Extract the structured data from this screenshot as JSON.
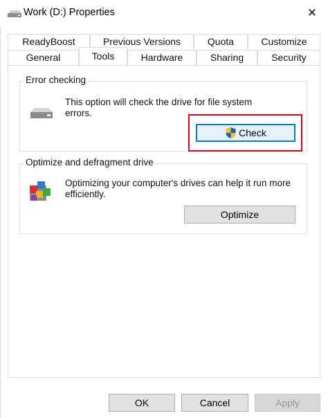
{
  "window": {
    "title": "Work (D:) Properties",
    "close_label": "✕"
  },
  "tabs_row1": [
    "ReadyBoost",
    "Previous Versions",
    "Quota",
    "Customize"
  ],
  "tabs_row2": [
    "General",
    "Tools",
    "Hardware",
    "Sharing",
    "Security"
  ],
  "active_tab": "Tools",
  "error_checking": {
    "label": "Error checking",
    "description": "This option will check the drive for file system errors.",
    "button": "Check"
  },
  "optimize": {
    "label": "Optimize and defragment drive",
    "description": "Optimizing your computer's drives can help it run more efficiently.",
    "button": "Optimize"
  },
  "footer": {
    "ok": "OK",
    "cancel": "Cancel",
    "apply": "Apply"
  },
  "colors": {
    "highlight": "#d6001c",
    "focus": "#0078d7"
  },
  "icons": [
    "drive-icon",
    "close-icon",
    "shield-icon",
    "defrag-icon"
  ]
}
